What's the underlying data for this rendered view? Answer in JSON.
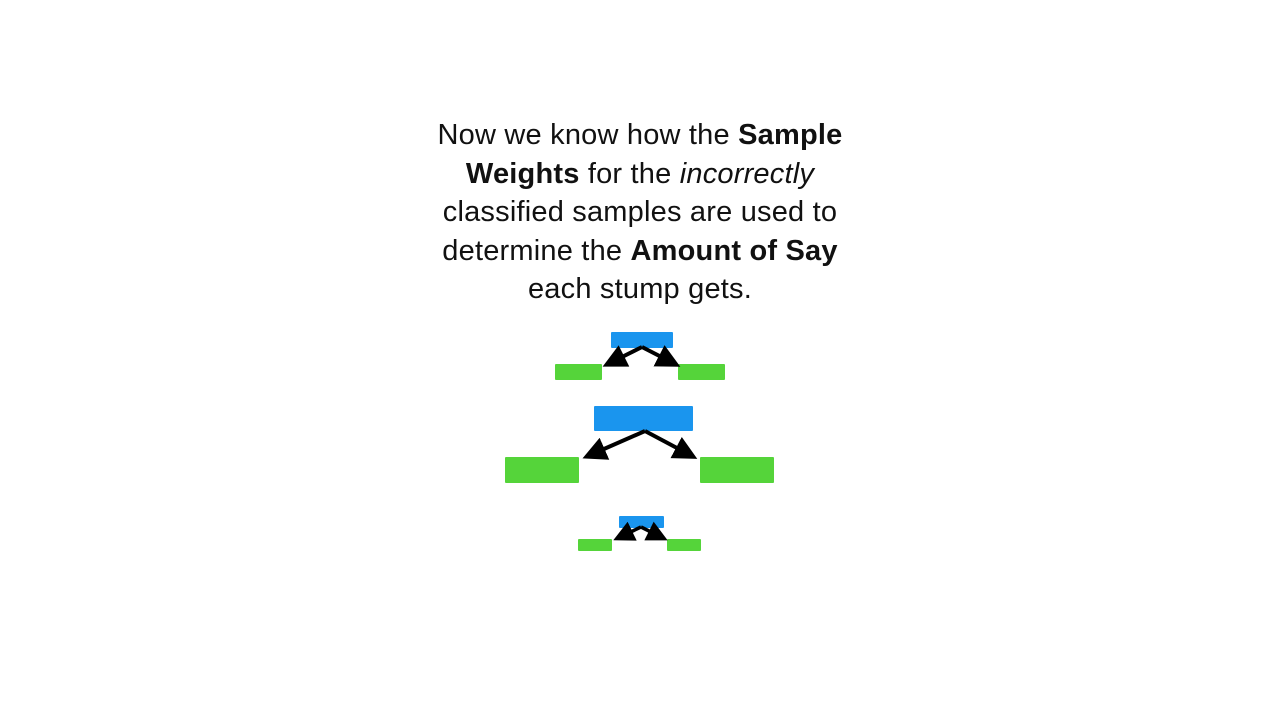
{
  "caption": {
    "line1": {
      "a": "Now we know how the ",
      "b": "Sample"
    },
    "line2": {
      "a": "Weights",
      "b": " for the ",
      "c": "incorrectly"
    },
    "line3": {
      "a": "classified samples are used to"
    },
    "line4": {
      "a": "determine the ",
      "b": "Amount of Say"
    },
    "line5": {
      "a": "each stump gets."
    }
  },
  "colors": {
    "root_node": "#1a95ee",
    "leaf_node": "#55d43a",
    "arrow": "#000000",
    "text": "#111111",
    "background": "#ffffff"
  },
  "stumps": [
    {
      "name": "stump-small-top",
      "relative_size": "small"
    },
    {
      "name": "stump-large-middle",
      "relative_size": "large"
    },
    {
      "name": "stump-smallest-bottom",
      "relative_size": "smallest"
    }
  ]
}
